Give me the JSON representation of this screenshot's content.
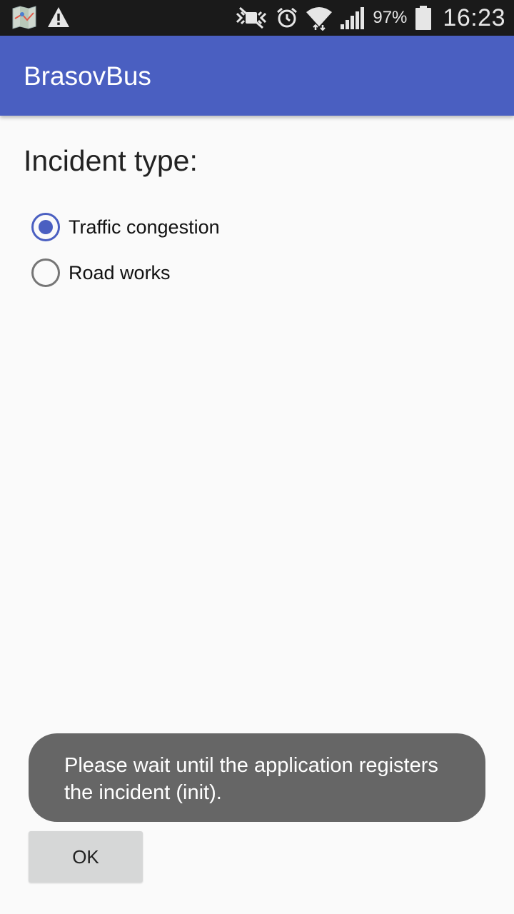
{
  "status_bar": {
    "icons_left": [
      "map-icon",
      "warning-icon"
    ],
    "icons_right": [
      "mute-icon",
      "alarm-icon",
      "wifi-icon",
      "signal-icon",
      "battery-icon"
    ],
    "battery_percent": "97%",
    "time": "16:23"
  },
  "app_bar": {
    "title": "BrasovBus",
    "color": "#4a5fc1"
  },
  "form": {
    "section_title": "Incident type:",
    "options": [
      {
        "label": "Traffic congestion",
        "checked": true
      },
      {
        "label": "Road works",
        "checked": false
      }
    ]
  },
  "toast": {
    "message": "Please wait until the application registers the incident (init)."
  },
  "actions": {
    "ok_label": "OK"
  }
}
